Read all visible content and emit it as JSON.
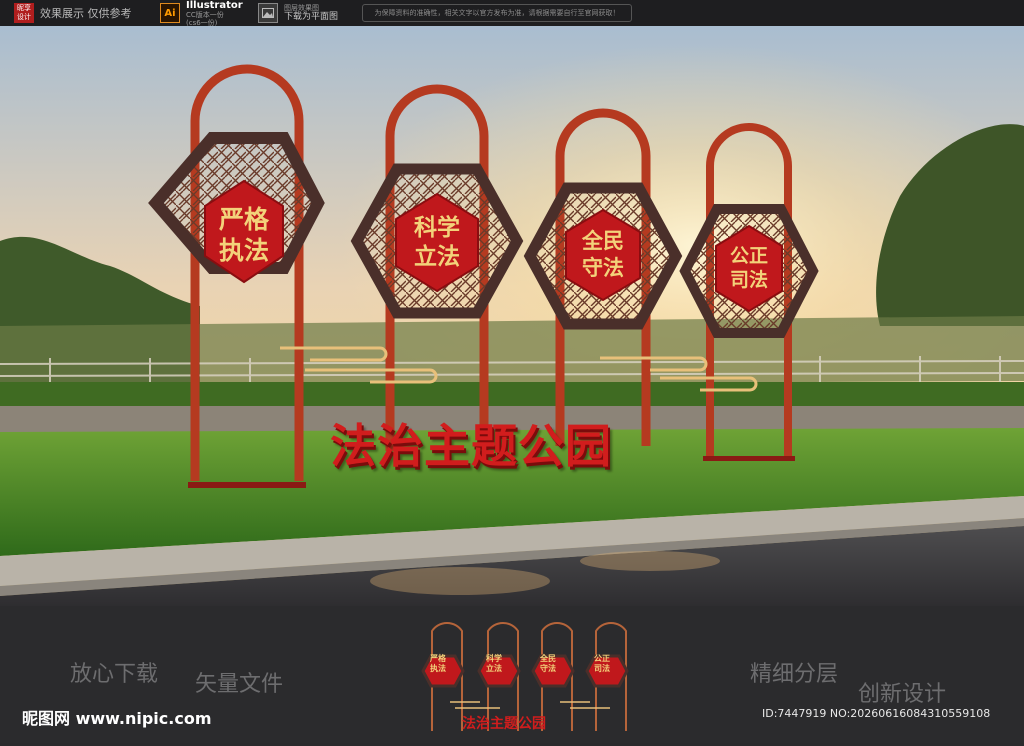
{
  "topbar": {
    "logo_text": "昵享设计",
    "effect_note": "效果展示 仅供参考",
    "ai_label": "Ai",
    "software_name": "Illustrator",
    "software_sub1": "CC版本一份",
    "software_sub2": "(cs6一份)",
    "image_sub": "图层效果图",
    "download_note": "下载为平面图",
    "notice": "为保障资料的准确性，相关文字以官方发布为准，请根据需要自行至官网获取！"
  },
  "signs": [
    {
      "line1": "严格",
      "line2": "执法"
    },
    {
      "line1": "科学",
      "line2": "立法"
    },
    {
      "line1": "全民",
      "line2": "守法"
    },
    {
      "line1": "公正",
      "line2": "司法"
    }
  ],
  "park_title": "法治主题公园",
  "bottom": {
    "wm_left1": "放心下载",
    "wm_left2": "矢量文件",
    "wm_right1": "精细分层",
    "wm_right2": "创新设计",
    "site_brand": "昵图网 www.nipic.com",
    "id_line": "ID:7447919 NO:20260616084310559108"
  },
  "colors": {
    "red": "#c0181c",
    "frame_brown": "#4a2f2a",
    "copper": "#b5643a",
    "gold": "#e8c07a",
    "grass": "#4f8c24"
  }
}
